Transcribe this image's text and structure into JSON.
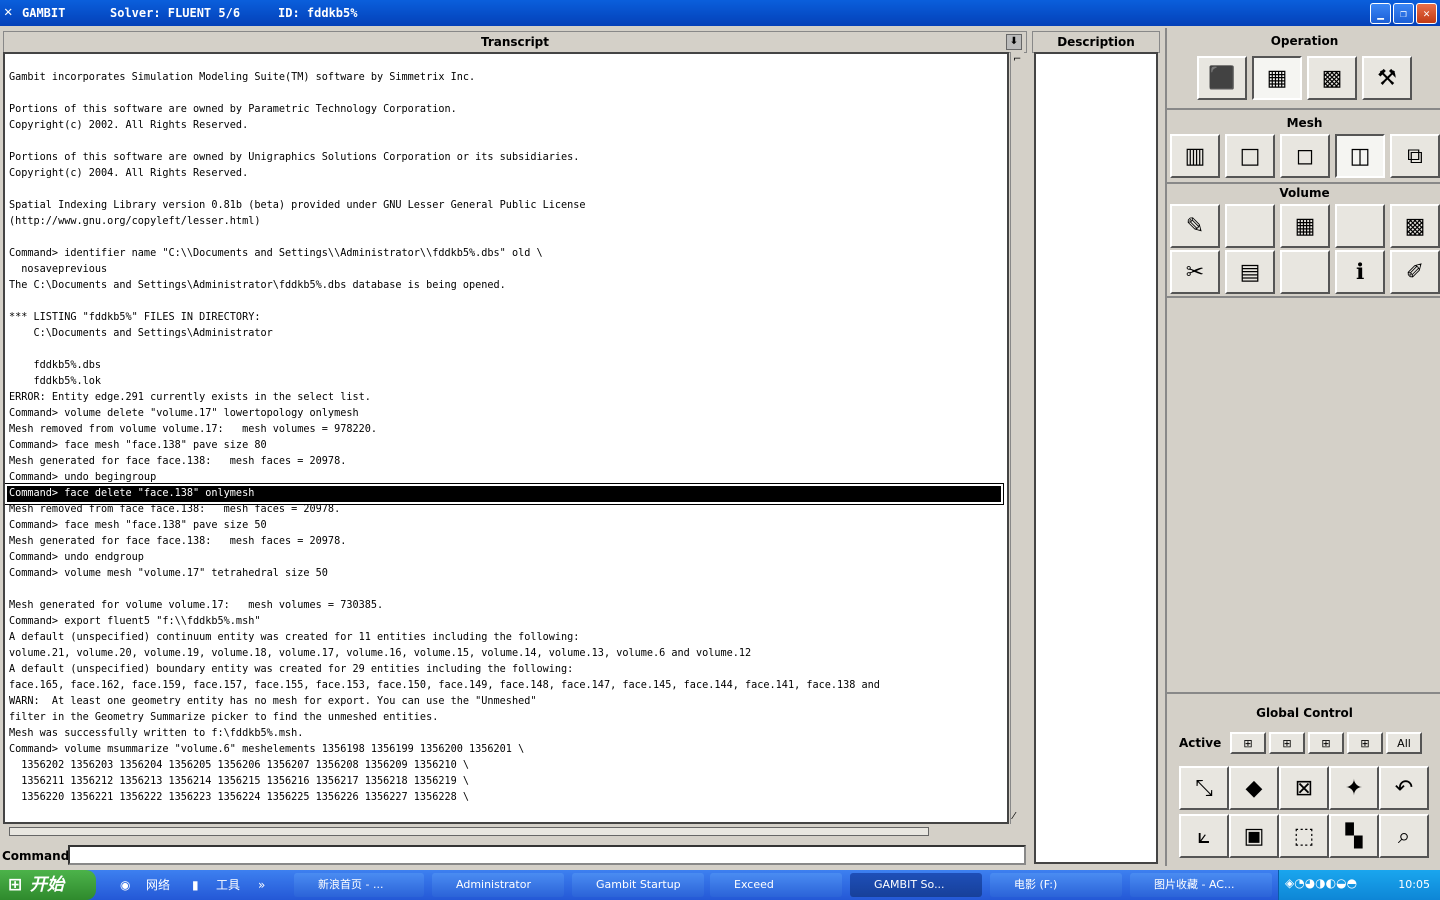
{
  "title": {
    "app": "GAMBIT",
    "solver": "Solver: FLUENT 5/6",
    "id": "ID: fddkb5%"
  },
  "transcript": {
    "header": "Transcript",
    "lines": [
      "",
      "Gambit incorporates Simulation Modeling Suite(TM) software by Simmetrix Inc.",
      "",
      "Portions of this software are owned by Parametric Technology Corporation.",
      "Copyright(c) 2002. All Rights Reserved.",
      "",
      "Portions of this software are owned by Unigraphics Solutions Corporation or its subsidiaries.",
      "Copyright(c) 2004. All Rights Reserved.",
      "",
      "Spatial Indexing Library version 0.81b (beta) provided under GNU Lesser General Public License",
      "(http://www.gnu.org/copyleft/lesser.html)",
      "",
      "Command> identifier name \"C:\\\\Documents and Settings\\\\Administrator\\\\fddkb5%.dbs\" old \\",
      "  nosaveprevious",
      "The C:\\Documents and Settings\\Administrator\\fddkb5%.dbs database is being opened.",
      "",
      "*** LISTING \"fddkb5%\" FILES IN DIRECTORY:",
      "    C:\\Documents and Settings\\Administrator",
      "",
      "    fddkb5%.dbs",
      "    fddkb5%.lok",
      "ERROR: Entity edge.291 currently exists in the select list.",
      "Command> volume delete \"volume.17\" lowertopology onlymesh",
      "Mesh removed from volume volume.17:   mesh volumes = 978220.",
      "Command> face mesh \"face.138\" pave size 80",
      "Mesh generated for face face.138:   mesh faces = 20978.",
      "Command> undo begingroup",
      "Command> face delete \"face.138\" onlymesh",
      "Mesh removed from face face.138:   mesh faces = 20978.",
      "Command> face mesh \"face.138\" pave size 50",
      "Mesh generated for face face.138:   mesh faces = 20978.",
      "Command> undo endgroup",
      "Command> volume mesh \"volume.17\" tetrahedral size 50",
      "",
      "Mesh generated for volume volume.17:   mesh volumes = 730385.",
      "Command> export fluent5 \"f:\\\\fddkb5%.msh\"",
      "A default (unspecified) continuum entity was created for 11 entities including the following:",
      "volume.21, volume.20, volume.19, volume.18, volume.17, volume.16, volume.15, volume.14, volume.13, volume.6 and volume.12",
      "A default (unspecified) boundary entity was created for 29 entities including the following:",
      "face.165, face.162, face.159, face.157, face.155, face.153, face.150, face.149, face.148, face.147, face.145, face.144, face.141, face.138 and",
      "WARN:  At least one geometry entity has no mesh for export. You can use the \"Unmeshed\"",
      "filter in the Geometry Summarize picker to find the unmeshed entities.",
      "Mesh was successfully written to f:\\fddkb5%.msh.",
      "Command> volume msummarize \"volume.6\" meshelements 1356198 1356199 1356200 1356201 \\",
      "  1356202 1356203 1356204 1356205 1356206 1356207 1356208 1356209 1356210 \\",
      "  1356211 1356212 1356213 1356214 1356215 1356216 1356217 1356218 1356219 \\",
      "  1356220 1356221 1356222 1356223 1356224 1356225 1356226 1356227 1356228 \\"
    ],
    "highlighted_index": 27
  },
  "description_header": "Description",
  "command": {
    "label": "Command:",
    "value": ""
  },
  "panel": {
    "operation": "Operation",
    "mesh": "Mesh",
    "volume": "Volume",
    "global_control": "Global Control",
    "active": "Active",
    "all": "All"
  },
  "taskbar": {
    "start": "开始",
    "quick": [
      "网络",
      "工具"
    ],
    "tasks": [
      "新浪首页 - ...",
      "Administrator",
      "Gambit Startup",
      "Exceed",
      "GAMBIT        So...",
      "电影 (F:)",
      "图片收藏 - AC..."
    ],
    "clock": "10:05"
  }
}
